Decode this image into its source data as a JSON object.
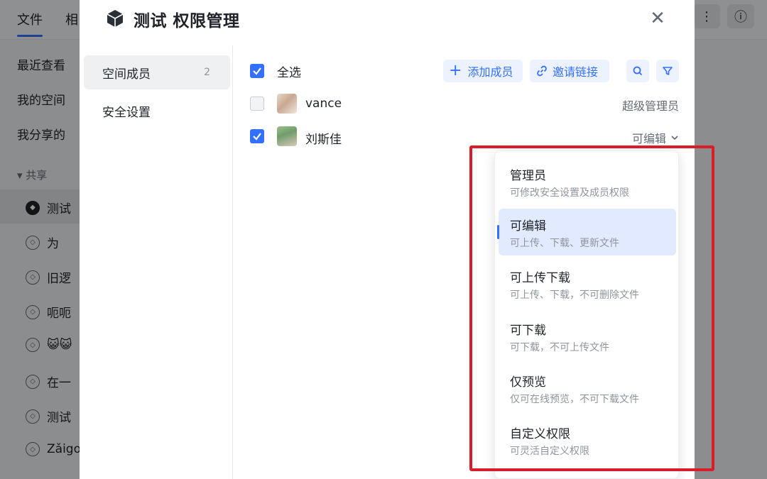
{
  "background": {
    "tabs": [
      {
        "label": "文件"
      },
      {
        "label": "相"
      }
    ],
    "sidebar": {
      "items": [
        {
          "label": "最近查看"
        },
        {
          "label": "我的空间"
        },
        {
          "label": "我分享的"
        }
      ],
      "group_label": "▾ 共享",
      "spaces": [
        {
          "label": "测试"
        },
        {
          "label": "为"
        },
        {
          "label": "旧逻"
        },
        {
          "label": "呃呃"
        },
        {
          "label": "😺😺"
        },
        {
          "label": "在一"
        },
        {
          "label": "测试"
        },
        {
          "label": "Zǎigo"
        }
      ]
    }
  },
  "modal": {
    "title": "测试 权限管理",
    "close_glyph": "✕",
    "nav": [
      {
        "label": "空间成员",
        "count": "2"
      },
      {
        "label": "安全设置"
      }
    ],
    "select_all_label": "全选",
    "toolbar": {
      "add_member_label": "添加成员",
      "invite_link_label": "邀请链接"
    },
    "members": [
      {
        "name": "vance",
        "role": "超级管理员",
        "checked": false
      },
      {
        "name": "刘斯佳",
        "role": "可编辑",
        "checked": true
      }
    ]
  },
  "dropdown": {
    "options": [
      {
        "title": "管理员",
        "desc": "可修改安全设置及成员权限",
        "selected": false
      },
      {
        "title": "可编辑",
        "desc": "可上传、下载、更新文件",
        "selected": true
      },
      {
        "title": "可上传下载",
        "desc": "可上传、下载，不可删除文件",
        "selected": false
      },
      {
        "title": "可下载",
        "desc": "可下载，不可上传文件",
        "selected": false
      },
      {
        "title": "仅预览",
        "desc": "仅可在线预览，不可下载文件",
        "selected": false
      },
      {
        "title": "自定义权限",
        "desc": "可灵活自定义权限",
        "selected": false
      }
    ]
  },
  "colors": {
    "accent": "#3370ff",
    "highlight": "#d81e2a"
  }
}
